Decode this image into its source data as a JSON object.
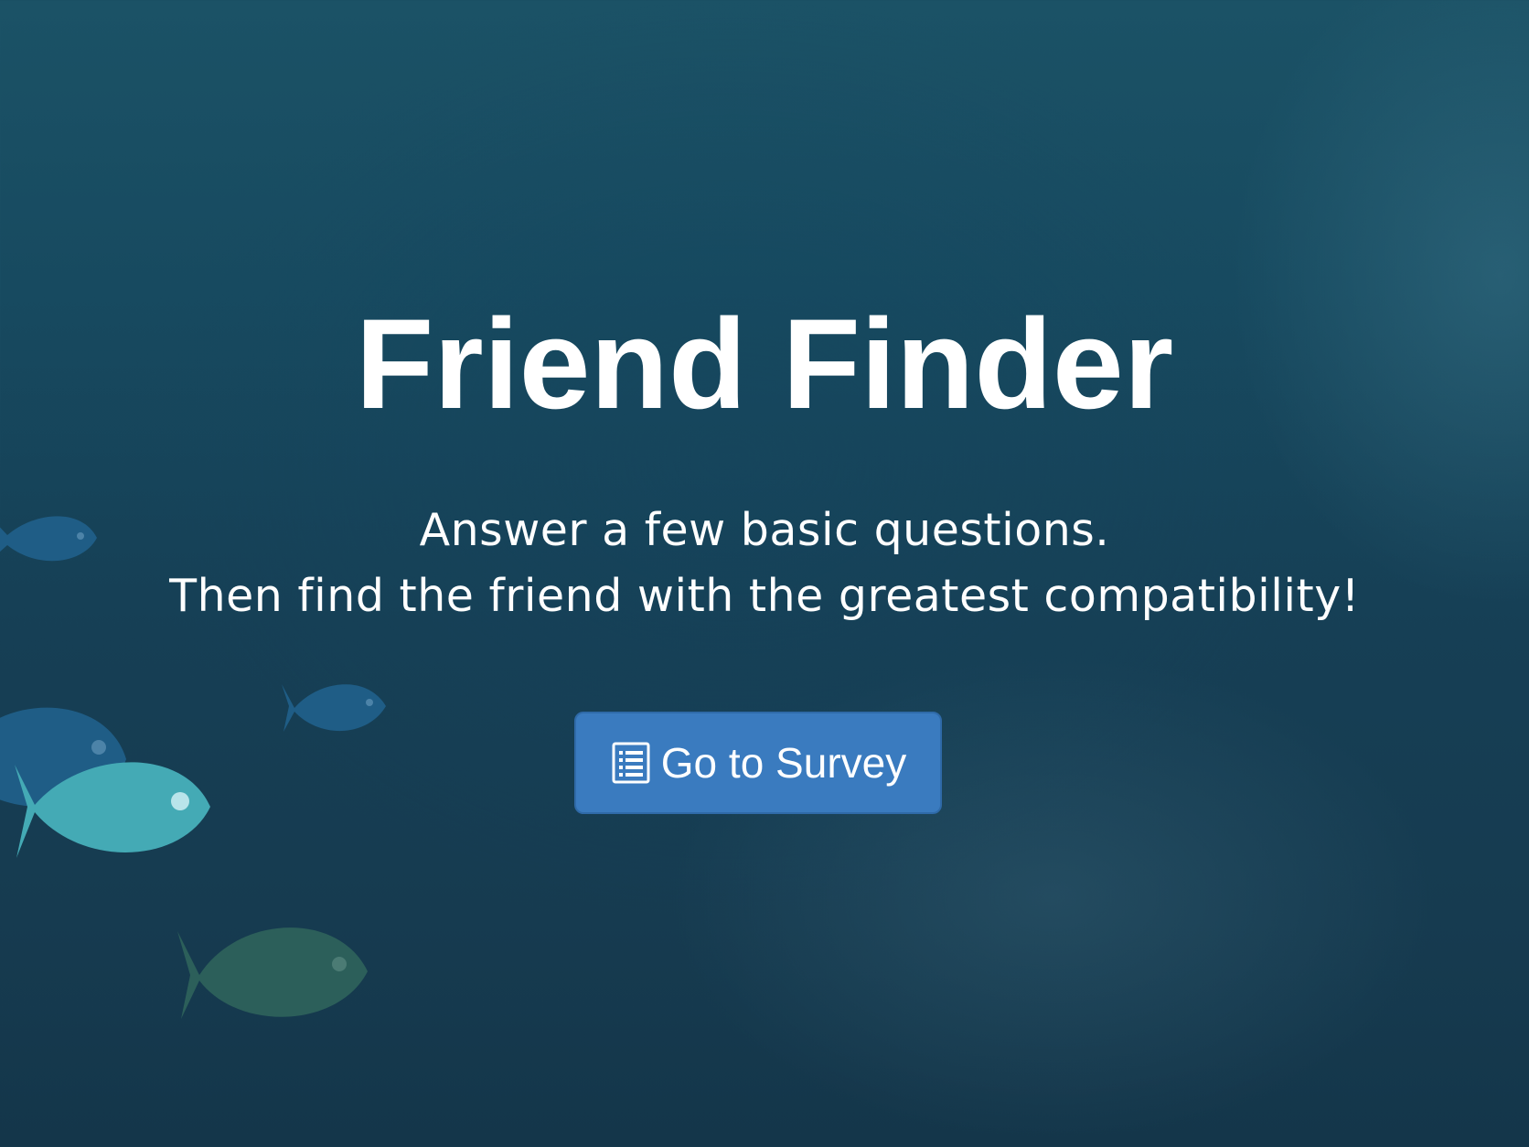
{
  "hero": {
    "title": "Friend Finder",
    "tagline_line1": "Answer a few basic questions.",
    "tagline_line2": "Then find the friend with the greatest compatibility!"
  },
  "survey_button": {
    "label": "Go to Survey",
    "icon": "list-alt-icon",
    "color": "#3a7bbf"
  },
  "background": {
    "theme": "underwater",
    "color": "#174a60",
    "fish_colors": [
      "#1f5d86",
      "#44aab5",
      "#2c5f5a"
    ]
  }
}
